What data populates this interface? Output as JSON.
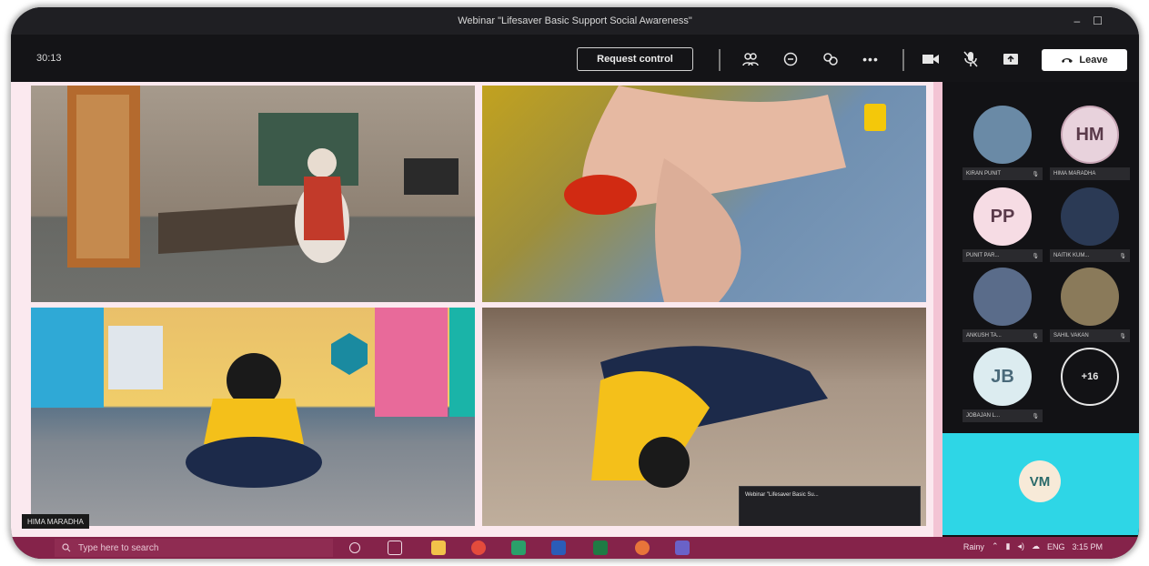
{
  "window": {
    "title": "Webinar \"Lifesaver Basic Support Social Awareness\""
  },
  "toolbar": {
    "timer": "30:13",
    "request_control_label": "Request control",
    "leave_label": "Leave",
    "icons": [
      "people-icon",
      "chat-icon",
      "reactions-icon",
      "more-icon",
      "camera-icon",
      "mic-off-icon",
      "share-icon"
    ]
  },
  "video_tiles": {
    "name_tag": "HIMA MARADHA"
  },
  "participants": [
    {
      "name": "KIRAN PUNIT",
      "type": "photo",
      "color": "#6a8aa6"
    },
    {
      "initials": "HM",
      "name": "HIMA MARADHA",
      "type": "initials",
      "color": "#e8d2dc"
    },
    {
      "initials": "PP",
      "name": "PUNIT PAR...",
      "type": "initials",
      "color": "#f6dce4"
    },
    {
      "name": "NAITIK KUM...",
      "type": "photo",
      "color": "#2b3a55"
    },
    {
      "name": "ANKUSH TA...",
      "type": "photo",
      "color": "#5a6c8a"
    },
    {
      "name": "SAHIL VAKAN",
      "type": "photo",
      "color": "#8a7a5a"
    },
    {
      "initials": "JB",
      "name": "JOBAJAN L...",
      "type": "initials",
      "color": "#dcecf0"
    }
  ],
  "overflow_count": "+16",
  "active_speaker": {
    "initials": "VM",
    "bg_color": "#2ed6e6"
  },
  "mini_window": {
    "title": "Webinar \"Lifesaver Basic Su..."
  },
  "taskbar": {
    "search_placeholder": "Type here to search",
    "tray_weather": "Rainy",
    "tray_lang": "ENG",
    "tray_time": "3:15 PM"
  }
}
